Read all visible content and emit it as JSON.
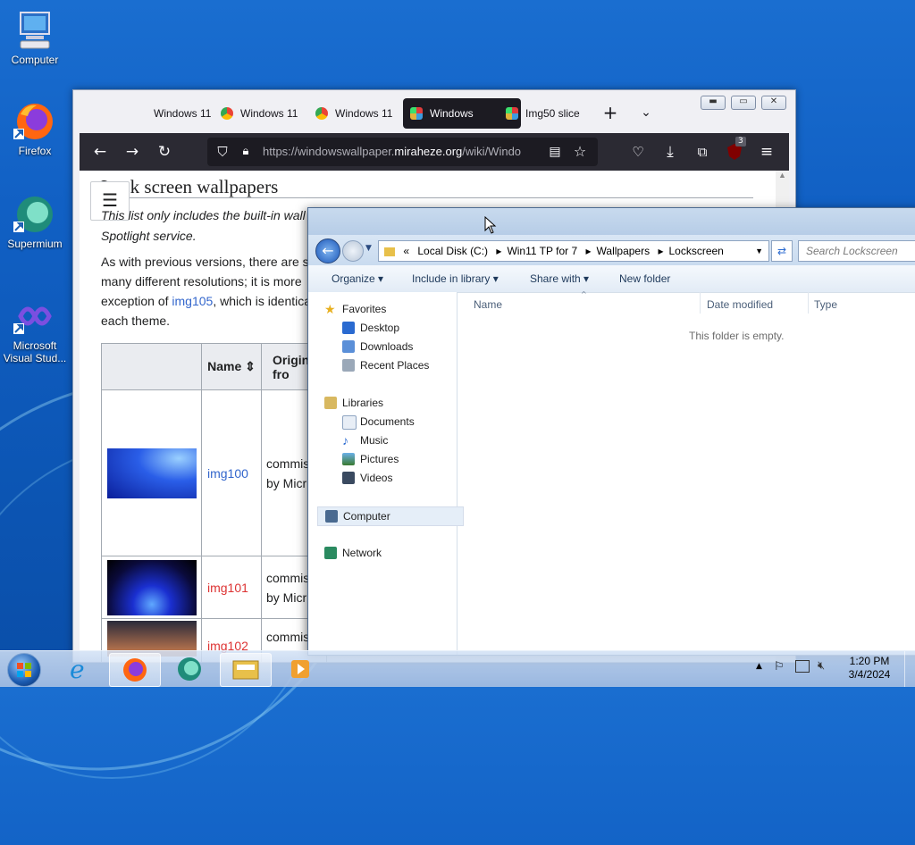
{
  "desktop": {
    "icons": [
      {
        "label": "Computer"
      },
      {
        "label": "Firefox"
      },
      {
        "label": "Supermium"
      },
      {
        "label": "Microsoft Visual Stud..."
      }
    ]
  },
  "browser": {
    "tabs": [
      {
        "label": "Windows 11"
      },
      {
        "label": "Windows 11"
      },
      {
        "label": "Windows 11"
      },
      {
        "label": "Windows",
        "active": true
      },
      {
        "label": "Img50 slice"
      }
    ],
    "url_prefix": "https://windowswallpaper.",
    "url_domain": "miraheze.org",
    "url_suffix": "/wiki/Windo",
    "extension_badge": "3",
    "page": {
      "heading": "Lock screen wallpapers",
      "intro_line1": "This list only includes the built-in wall",
      "intro_line2": "Spotlight service.",
      "para_line1": "As with previous versions, there are s",
      "para_line2": "many different resolutions; it is more",
      "para_line3_a": "exception of ",
      "para_line3_link": "img105",
      "para_line3_b": ", which is identica",
      "para_line4": "each theme.",
      "table": {
        "col_name": "Name",
        "col_origin": "Origin fro",
        "rows": [
          {
            "name": "img100",
            "origin_a": "commis",
            "origin_b": "by Micr"
          },
          {
            "name": "img101",
            "origin_a": "commis",
            "origin_b": "by Micr"
          },
          {
            "name": "img102",
            "origin_a": "commis",
            "origin_b": ""
          }
        ]
      }
    }
  },
  "explorer": {
    "breadcrumb": [
      "Local Disk (C:)",
      "Win11 TP for 7",
      "Wallpapers",
      "Lockscreen"
    ],
    "breadcrumb_prefix": "«",
    "search_placeholder": "Search Lockscreen",
    "commands": {
      "organize": "Organize",
      "include": "Include in library",
      "share": "Share with",
      "new_folder": "New folder"
    },
    "nav": {
      "favorites": "Favorites",
      "desktop": "Desktop",
      "downloads": "Downloads",
      "recent": "Recent Places",
      "libraries": "Libraries",
      "documents": "Documents",
      "music": "Music",
      "pictures": "Pictures",
      "videos": "Videos",
      "computer": "Computer",
      "network": "Network"
    },
    "columns": {
      "name": "Name",
      "date": "Date modified",
      "type": "Type"
    },
    "empty_message": "This folder is empty."
  },
  "taskbar": {
    "time": "1:20 PM",
    "date": "3/4/2024"
  }
}
